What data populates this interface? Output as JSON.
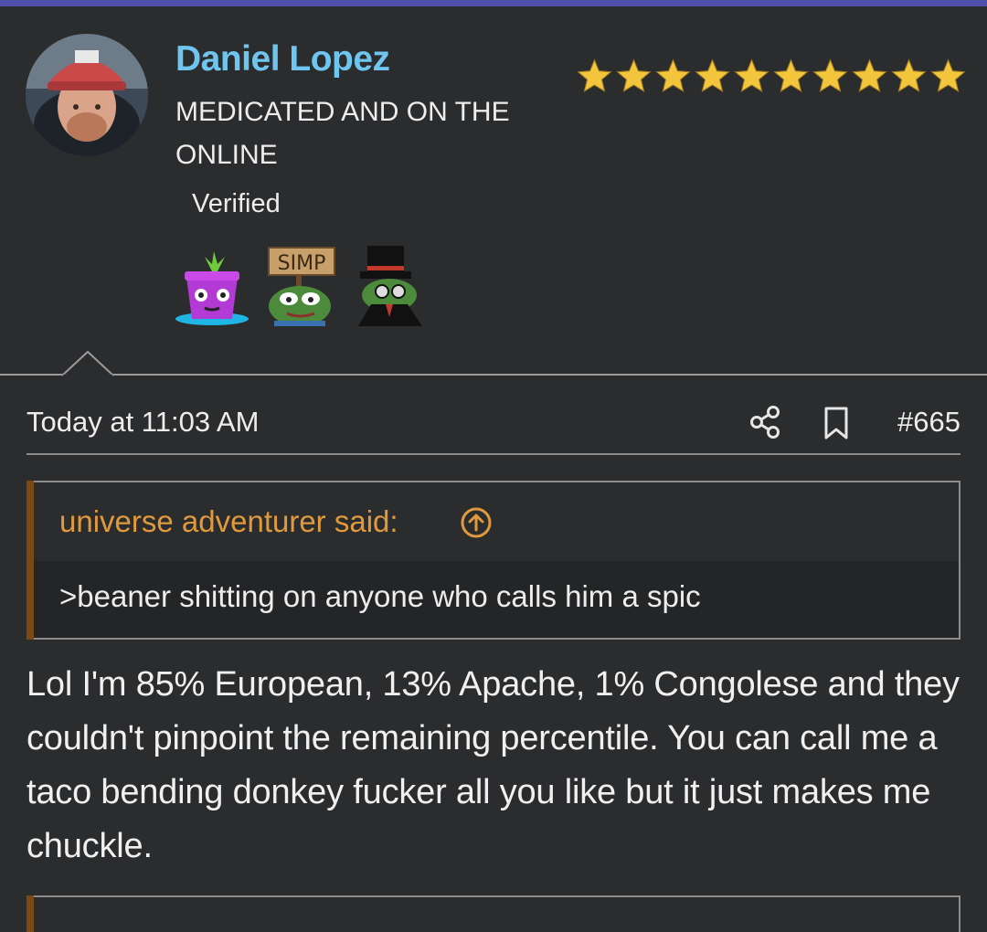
{
  "user": {
    "name": "Daniel Lopez",
    "title": "MEDICATED AND ON THE ONLINE",
    "status": "Verified",
    "star_count": 10,
    "badges": [
      "purple-plant-badge-icon",
      "simp-pepe-badge-icon",
      "top-hat-pepe-badge-icon"
    ],
    "badge_sign_text": "SIMP"
  },
  "post": {
    "date": "Today at 11:03 AM",
    "number": "#665",
    "quote": {
      "author": "universe adventurer said:",
      "text": ">beaner shitting on anyone who calls him a spic"
    },
    "body": "Lol I'm 85% European, 13% Apache, 1% Congolese and they couldn't pinpoint the remaining percentile. You can call me a taco bending donkey fucker all you like but it just makes me chuckle."
  },
  "colors": {
    "background": "#2b2c2e",
    "username": "#6fc5ee",
    "quote_author": "#e09a3c",
    "star": "#f2c53d",
    "top_bar": "#4e4fa8"
  }
}
